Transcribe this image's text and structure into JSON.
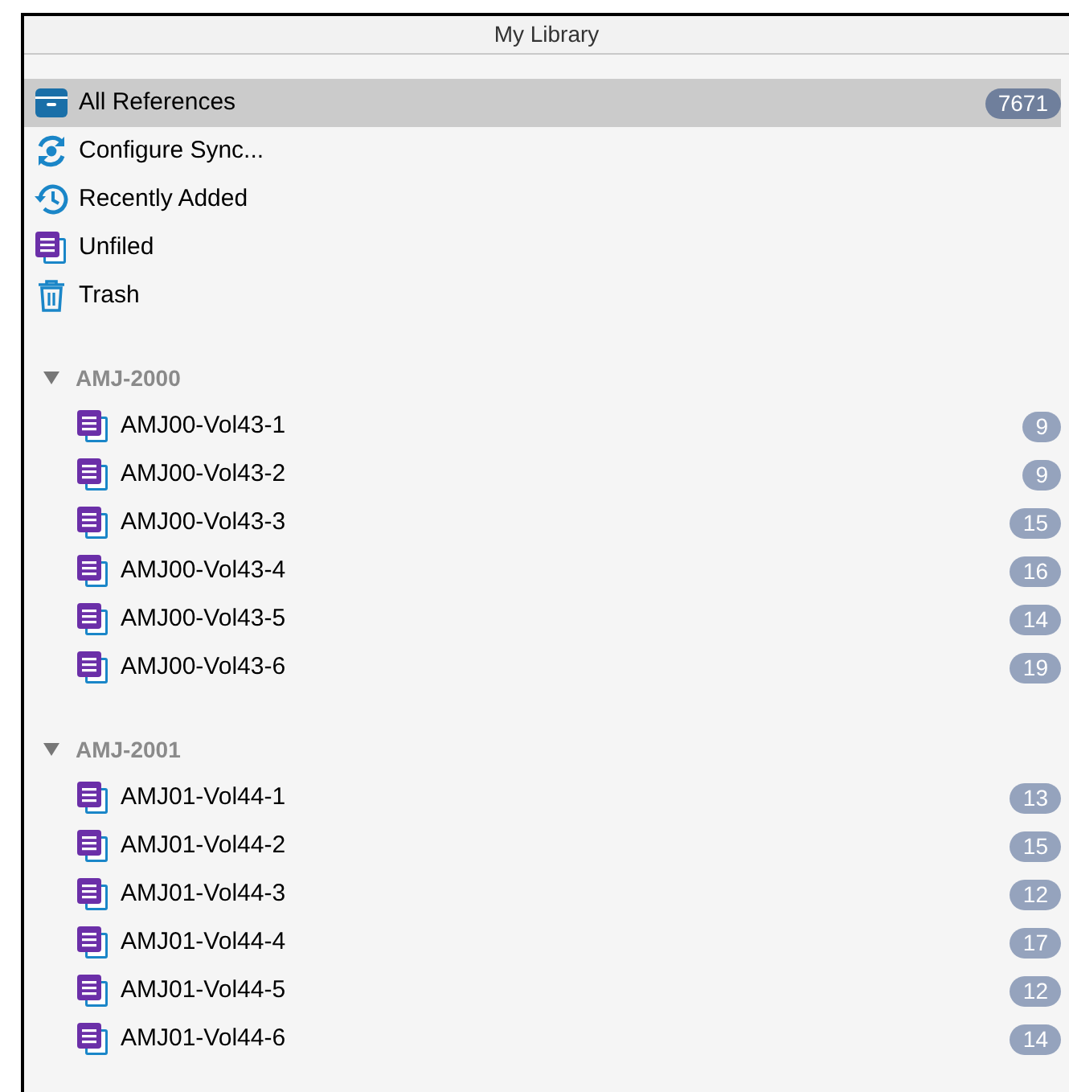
{
  "header": {
    "title": "My Library"
  },
  "items": [
    {
      "kind": "library",
      "label": "All References",
      "count": "7671",
      "selected": true
    },
    {
      "kind": "sync",
      "label": "Configure Sync...",
      "selected": false
    },
    {
      "kind": "recent",
      "label": "Recently Added",
      "selected": false
    },
    {
      "kind": "unfiled",
      "label": "Unfiled",
      "selected": false
    },
    {
      "kind": "trash",
      "label": "Trash",
      "selected": false
    }
  ],
  "groups": [
    {
      "label": "AMJ-2000",
      "expanded": true,
      "children": [
        {
          "label": "AMJ00-Vol43-1",
          "count": "9",
          "selected": false
        },
        {
          "label": "AMJ00-Vol43-2",
          "count": "9",
          "selected": false
        },
        {
          "label": "AMJ00-Vol43-3",
          "count": "15",
          "selected": false
        },
        {
          "label": "AMJ00-Vol43-4",
          "count": "16",
          "selected": false
        },
        {
          "label": "AMJ00-Vol43-5",
          "count": "14",
          "selected": false
        },
        {
          "label": "AMJ00-Vol43-6",
          "count": "19",
          "selected": false
        }
      ]
    },
    {
      "label": "AMJ-2001",
      "expanded": true,
      "children": [
        {
          "label": "AMJ01-Vol44-1",
          "count": "13",
          "selected": false
        },
        {
          "label": "AMJ01-Vol44-2",
          "count": "15",
          "selected": false
        },
        {
          "label": "AMJ01-Vol44-3",
          "count": "12",
          "selected": false
        },
        {
          "label": "AMJ01-Vol44-4",
          "count": "17",
          "selected": false
        },
        {
          "label": "AMJ01-Vol44-5",
          "count": "12",
          "selected": false
        },
        {
          "label": "AMJ01-Vol44-6",
          "count": "14",
          "selected": false
        }
      ]
    }
  ]
}
